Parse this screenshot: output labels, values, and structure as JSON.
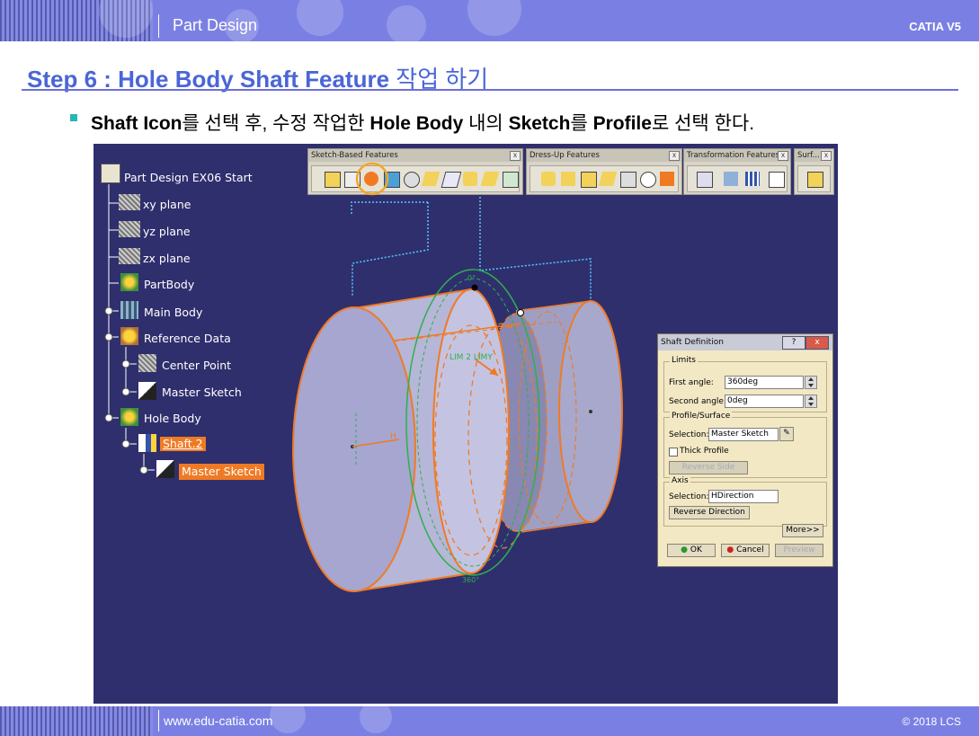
{
  "header": {
    "section": "Part Design",
    "product": "CATIA V5"
  },
  "footer": {
    "url": "www.edu-catia.com",
    "copyright": "© 2018 LCS"
  },
  "slide": {
    "title_en": "Step 6 : Hole Body Shaft Feature",
    "title_ko": " 작업 하기",
    "bullet": {
      "p1": "Shaft Icon",
      "p2": "를 선택 후, 수정 작업한 ",
      "p3": "Hole Body",
      "p4": " 내의 ",
      "p5": "Sketch",
      "p6": "를 ",
      "p7": "Profile",
      "p8": "로 선택 한다."
    }
  },
  "tree": {
    "root": "Part Design EX06 Start",
    "xy": "xy plane",
    "yz": "yz plane",
    "zx": "zx plane",
    "partbody": "PartBody",
    "mainbody": "Main Body",
    "refdata": "Reference Data",
    "center": "Center Point",
    "mastersketch": "Master Sketch",
    "holebody": "Hole Body",
    "shaft": "Shaft.2",
    "mastersketch2": "Master Sketch"
  },
  "toolbars": {
    "sketch_based": "Sketch-Based Features",
    "dress_up": "Dress-Up Features",
    "transformation": "Transformation Features",
    "surface": "Surf..."
  },
  "viewport": {
    "angle_top": "0°",
    "angle_bottom": "360°",
    "axis_label": "LIM 2 LIMY",
    "h_label": "H"
  },
  "dialog": {
    "title": "Shaft Definition",
    "limits": "Limits",
    "first_angle_label": "First angle:",
    "first_angle": "360deg",
    "second_angle_label": "Second angle:",
    "second_angle": "0deg",
    "profile_group": "Profile/Surface",
    "selection_label": "Selection:",
    "profile_selection": "Master Sketch",
    "thick_profile": "Thick Profile",
    "reverse_side": "Reverse Side",
    "axis_group": "Axis",
    "axis_selection_label": "Selection:",
    "axis_selection": "HDirection",
    "reverse_direction": "Reverse Direction",
    "more": "More>>",
    "ok": "OK",
    "cancel": "Cancel",
    "preview": "Preview"
  },
  "colors": {
    "band": "#7a80e3",
    "title": "#4a66d6",
    "viewport": "#2f2f6e",
    "highlight": "#f07a24",
    "dialog": "#f2e8c4",
    "accent_bullet": "#27b6b6"
  }
}
